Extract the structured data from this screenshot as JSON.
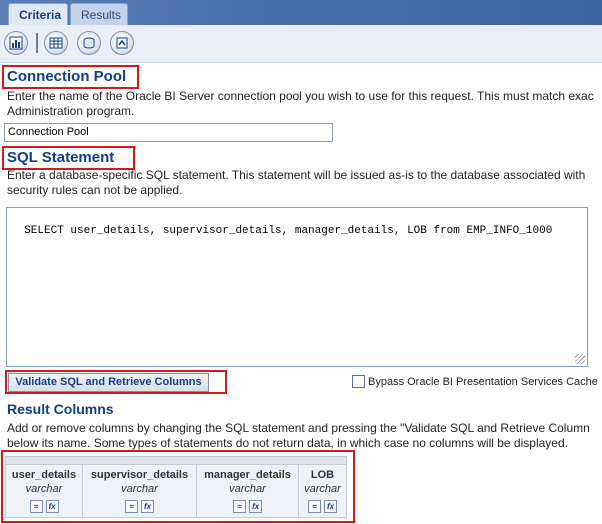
{
  "tabs": [
    {
      "label": "Criteria",
      "active": true
    },
    {
      "label": "Results",
      "active": false
    }
  ],
  "toolbar": {
    "icons": [
      "report-icon",
      "table-icon",
      "database-icon",
      "refresh-icon"
    ]
  },
  "connection_pool": {
    "heading": "Connection Pool",
    "description_line1": "Enter the name of the Oracle BI Server connection pool you wish to use for this request. This must match exac",
    "description_line2": "Administration program.",
    "value": "Connection Pool"
  },
  "sql_statement": {
    "heading": "SQL Statement",
    "description_line1": "Enter a database-specific SQL statement. This statement will be issued as-is to the database associated with",
    "description_line2": "security rules can not be applied.",
    "value": "SELECT user_details, supervisor_details, manager_details, LOB from EMP_INFO_1000"
  },
  "validate_button_label": "Validate SQL and Retrieve Columns",
  "bypass_cache": {
    "label": "Bypass Oracle BI Presentation Services Cache",
    "checked": false
  },
  "result_columns": {
    "heading": "Result Columns",
    "description_line1": "Add or remove columns by changing the SQL statement and pressing the \"Validate SQL and Retrieve Column",
    "description_line2": "below its name. Some types of statements do not return data, in which case no columns will be displayed.",
    "columns": [
      {
        "name": "user_details",
        "type": "varchar"
      },
      {
        "name": "supervisor_details",
        "type": "varchar"
      },
      {
        "name": "manager_details",
        "type": "varchar"
      },
      {
        "name": "LOB",
        "type": "varchar"
      }
    ]
  },
  "colors": {
    "heading": "#123f86",
    "highlight_box": "#d11b1b",
    "tabbar": "#4a70ab"
  }
}
